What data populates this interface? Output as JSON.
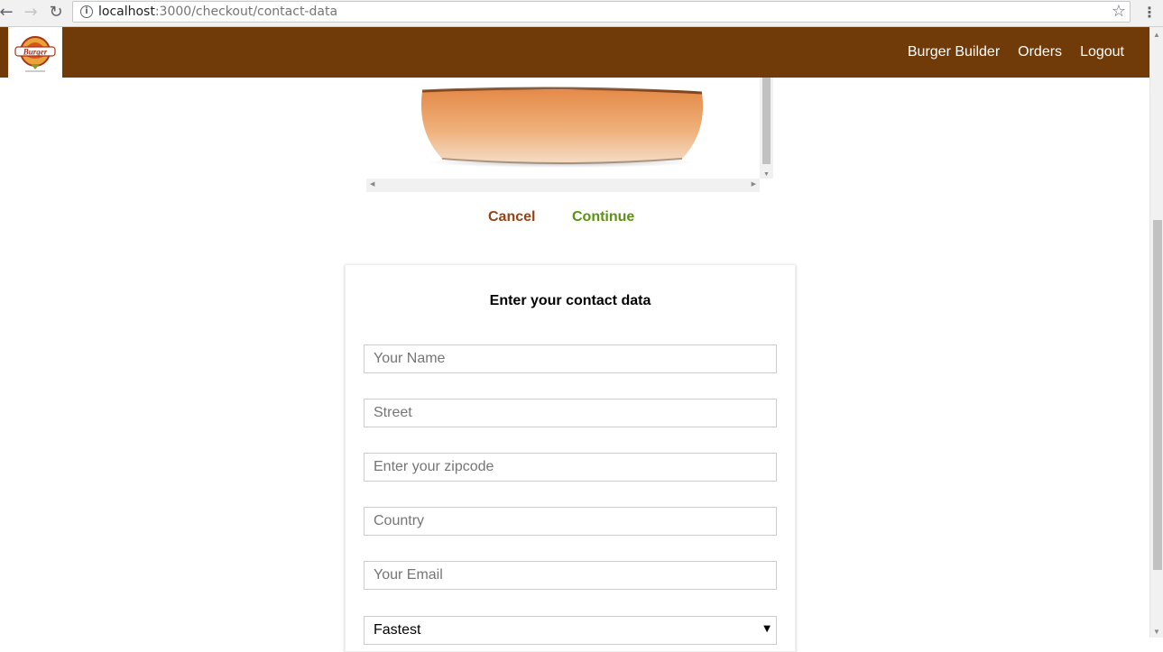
{
  "browser": {
    "url_host": "localhost",
    "url_path": ":3000/checkout/contact-data",
    "back_glyph": "←",
    "forward_glyph": "→",
    "reload_glyph": "↻",
    "info_glyph": "i",
    "star_glyph": "☆",
    "menu_glyph": "⋮"
  },
  "header": {
    "logo_text": "Burger",
    "nav": [
      "Burger Builder",
      "Orders",
      "Logout"
    ],
    "color": "#703b09"
  },
  "checkout": {
    "cancel_label": "Cancel",
    "continue_label": "Continue",
    "cancel_color": "#944317",
    "continue_color": "#5c9210"
  },
  "contact": {
    "title": "Enter your contact data",
    "fields": {
      "name_placeholder": "Your Name",
      "street_placeholder": "Street",
      "zipcode_placeholder": "Enter your zipcode",
      "country_placeholder": "Country",
      "email_placeholder": "Your Email"
    },
    "delivery_method": "Fastest"
  }
}
